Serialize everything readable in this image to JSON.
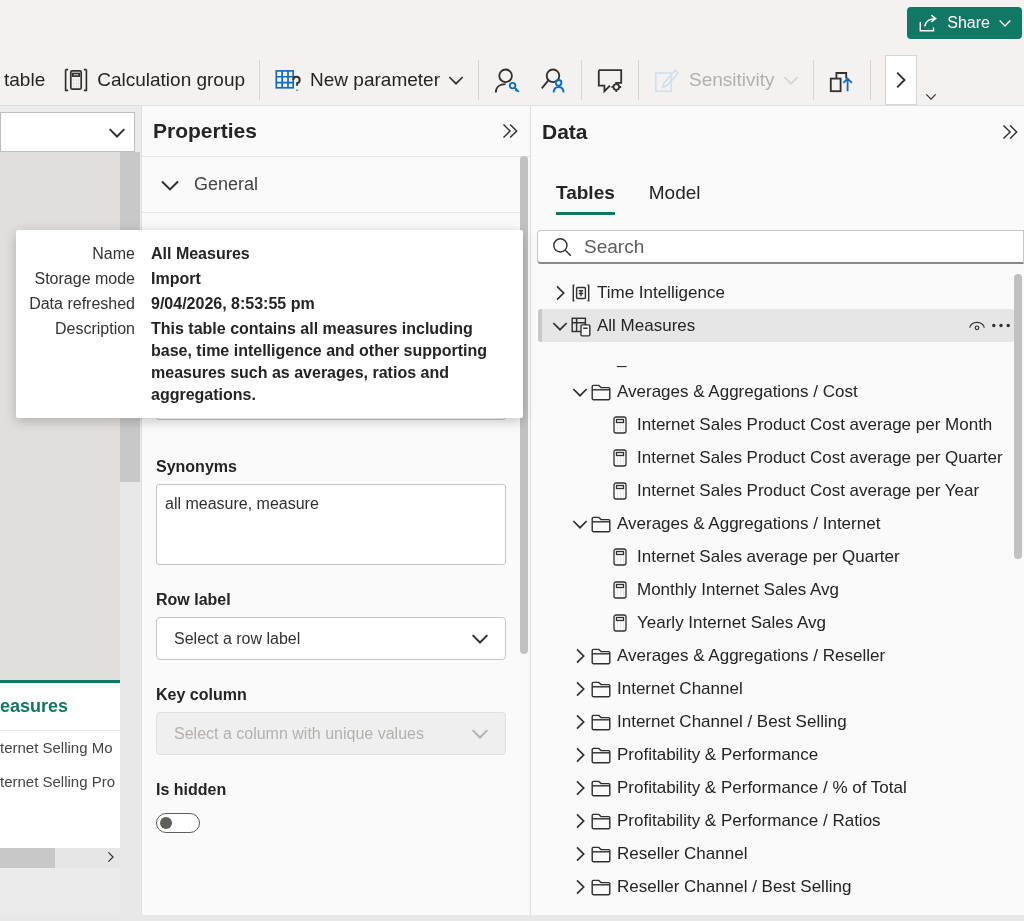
{
  "top_bar": {
    "share_button": {
      "label": "Share"
    }
  },
  "ribbon": {
    "groups": [
      [
        {
          "kind": "text",
          "label": "table",
          "menu": false,
          "disabled": false
        },
        {
          "kind": "text",
          "label": "Calculation group",
          "menu": false,
          "disabled": false
        }
      ],
      [
        {
          "kind": "text",
          "label": "New parameter",
          "menu": true,
          "disabled": false
        }
      ],
      [
        {
          "kind": "icon",
          "disabled": false
        },
        {
          "kind": "icon",
          "disabled": false
        }
      ],
      [
        {
          "kind": "icon",
          "disabled": false
        }
      ],
      [
        {
          "kind": "text",
          "label": "Sensitivity",
          "menu": true,
          "disabled": true
        }
      ],
      [
        {
          "kind": "icon",
          "disabled": false
        }
      ]
    ]
  },
  "canvas": {
    "visual": {
      "title": "easures",
      "rows": [
        "ternet Selling Mo",
        "ternet Selling Pro"
      ]
    }
  },
  "properties": {
    "title": "Properties",
    "section": {
      "label": "General",
      "expanded": true
    },
    "fields": [
      {
        "kind": "textarea",
        "label": "Synonyms",
        "value": "all measure, measure",
        "disabled": false
      },
      {
        "kind": "select",
        "label": "Row label",
        "placeholder": "Select a row label",
        "disabled": false
      },
      {
        "kind": "select",
        "label": "Key column",
        "placeholder": "Select a column with unique values",
        "disabled": true
      },
      {
        "kind": "toggle",
        "label": "Is hidden",
        "on": false,
        "disabled": false
      }
    ]
  },
  "data": {
    "title": "Data",
    "tabs": [
      {
        "label": "Tables",
        "selected": true
      },
      {
        "label": "Model",
        "selected": false
      }
    ],
    "search": {
      "placeholder": "Search"
    },
    "tree": [
      {
        "kind": "table",
        "label": "Time Intelligence",
        "expanded": false,
        "selected": false
      },
      {
        "kind": "measure-table",
        "label": "All Measures",
        "expanded": true,
        "selected": true,
        "children": [
          {
            "kind": "blank",
            "label": "_",
            "selected": false
          },
          {
            "kind": "folder",
            "label": "Averages & Aggregations / Cost",
            "expanded": true,
            "selected": false,
            "children": [
              {
                "kind": "measure",
                "label": "Internet Sales Product Cost average per Month",
                "selected": false
              },
              {
                "kind": "measure",
                "label": "Internet Sales Product Cost average per Quarter",
                "selected": false
              },
              {
                "kind": "measure",
                "label": "Internet Sales Product Cost average per Year",
                "selected": false
              }
            ]
          },
          {
            "kind": "folder",
            "label": "Averages & Aggregations / Internet",
            "expanded": true,
            "selected": false,
            "children": [
              {
                "kind": "measure",
                "label": "Internet Sales average per Quarter",
                "selected": false
              },
              {
                "kind": "measure",
                "label": "Monthly Internet Sales Avg",
                "selected": false
              },
              {
                "kind": "measure",
                "label": "Yearly Internet Sales Avg",
                "selected": false
              }
            ]
          },
          {
            "kind": "folder",
            "label": "Averages & Aggregations / Reseller",
            "expanded": false,
            "selected": false
          },
          {
            "kind": "folder",
            "label": "Internet Channel",
            "expanded": false,
            "selected": false
          },
          {
            "kind": "folder",
            "label": "Internet Channel / Best Selling",
            "expanded": false,
            "selected": false
          },
          {
            "kind": "folder",
            "label": "Profitability & Performance",
            "expanded": false,
            "selected": false
          },
          {
            "kind": "folder",
            "label": "Profitability & Performance / % of Total",
            "expanded": false,
            "selected": false
          },
          {
            "kind": "folder",
            "label": "Profitability & Performance / Ratios",
            "expanded": false,
            "selected": false
          },
          {
            "kind": "folder",
            "label": "Reseller Channel",
            "expanded": false,
            "selected": false
          },
          {
            "kind": "folder",
            "label": "Reseller Channel / Best Selling",
            "expanded": false,
            "selected": false
          }
        ]
      }
    ]
  },
  "tooltip": {
    "rows": [
      {
        "label": "Name",
        "value": "All Measures"
      },
      {
        "label": "Storage mode",
        "value": "Import"
      },
      {
        "label": "Data refreshed",
        "value": "9/04/2026, 8:53:55 pm"
      },
      {
        "label": "Description",
        "value": "This table contains all measures including base, time intelligence and other supporting measures such as averages, ratios and aggregations."
      }
    ]
  }
}
